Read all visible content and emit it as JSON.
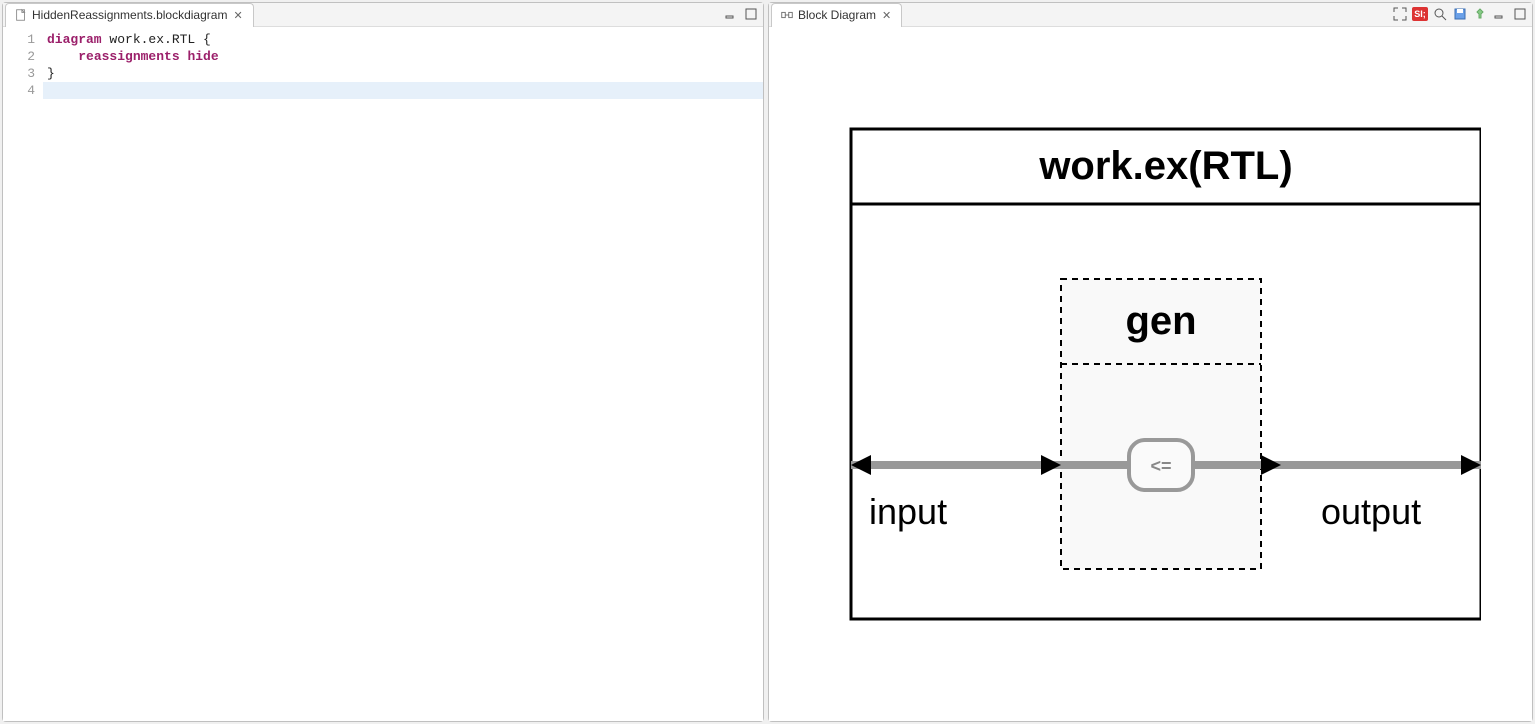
{
  "leftPane": {
    "tab": {
      "title": "HiddenReassignments.blockdiagram",
      "iconName": "file-icon",
      "close": "close-icon"
    },
    "code": {
      "lines": [
        {
          "num": "1",
          "tokens": [
            {
              "t": "diagram",
              "cls": "kw"
            },
            {
              "t": " work.ex.RTL {",
              "cls": "plain"
            }
          ]
        },
        {
          "num": "2",
          "tokens": [
            {
              "t": "    ",
              "cls": "plain"
            },
            {
              "t": "reassignments",
              "cls": "kw"
            },
            {
              "t": " ",
              "cls": "plain"
            },
            {
              "t": "hide",
              "cls": "kw"
            }
          ]
        },
        {
          "num": "3",
          "tokens": [
            {
              "t": "}",
              "cls": "plain"
            }
          ]
        },
        {
          "num": "4",
          "tokens": []
        }
      ],
      "highlightLine": 4
    }
  },
  "rightPane": {
    "tab": {
      "title": "Block Diagram",
      "iconName": "diagram-icon",
      "close": "close-icon"
    },
    "toolbar": {
      "icons": [
        "fit-icon",
        "si-badge",
        "zoom-icon",
        "save-icon",
        "pin-icon",
        "minimize-icon",
        "maximize-icon"
      ]
    },
    "diagram": {
      "title": "work.ex(RTL)",
      "block": {
        "label": "gen",
        "operator": "<="
      },
      "inputLabel": "input",
      "outputLabel": "output"
    }
  }
}
